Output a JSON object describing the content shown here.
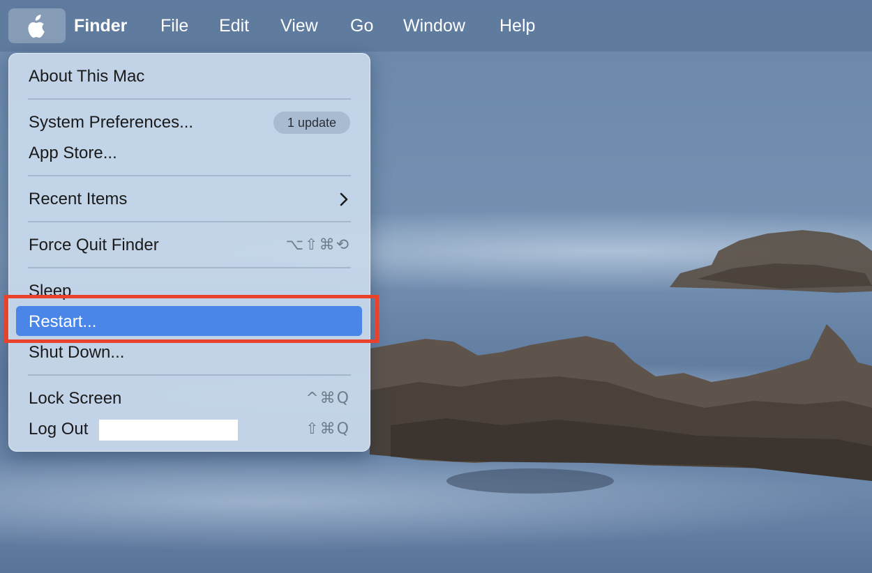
{
  "menubar": {
    "apple_icon": "apple-logo-icon",
    "items": [
      {
        "label": "Finder"
      },
      {
        "label": "File"
      },
      {
        "label": "Edit"
      },
      {
        "label": "View"
      },
      {
        "label": "Go"
      },
      {
        "label": "Window"
      },
      {
        "label": "Help"
      }
    ]
  },
  "apple_menu": {
    "about": "About This Mac",
    "system_preferences": "System Preferences...",
    "update_badge": "1 update",
    "app_store": "App Store...",
    "recent_items": "Recent Items",
    "force_quit": "Force Quit Finder",
    "force_quit_shortcut": "⌥⇧⌘⟲",
    "sleep": "Sleep",
    "restart": "Restart...",
    "shut_down": "Shut Down...",
    "lock_screen": "Lock Screen",
    "lock_screen_shortcut": "^⌘Q",
    "log_out": "Log Out",
    "log_out_shortcut": "⇧⌘Q"
  },
  "colors": {
    "menubar_bg": "#5e7a9d",
    "menu_bg": "#c6d6e9",
    "highlight": "#4a86e8",
    "annotation": "#e8412c"
  }
}
